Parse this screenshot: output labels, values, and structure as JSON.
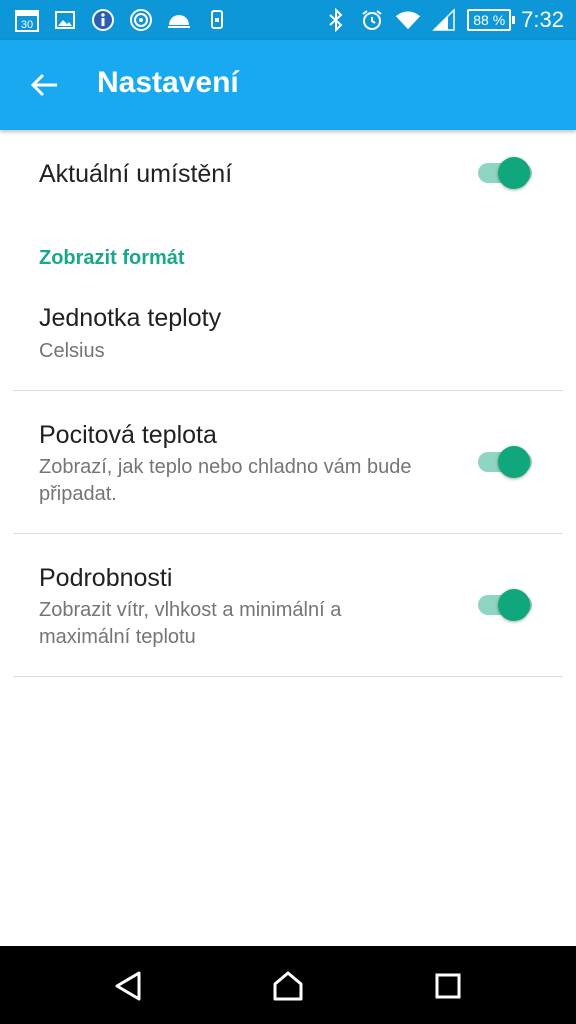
{
  "status_bar": {
    "notification_icons": [
      "calendar-icon",
      "photo-icon",
      "info-icon",
      "hotspot-icon",
      "weather-icon",
      "phone-sync-icon"
    ],
    "calendar_day": "30",
    "battery": "88 %",
    "time": "7:32"
  },
  "app_bar": {
    "title": "Nastavení",
    "back_icon": "arrow-left-icon",
    "color": "#18a9f1"
  },
  "settings": {
    "current_location": {
      "title": "Aktuální umístění",
      "enabled": true
    },
    "category_display_format": "Zobrazit formát",
    "temperature_unit": {
      "title": "Jednotka teploty",
      "value": "Celsius"
    },
    "feels_like": {
      "title": "Pocitová teplota",
      "summary": "Zobrazí, jak teplo nebo chladno vám bude připadat.",
      "enabled": true
    },
    "details": {
      "title": "Podrobnosti",
      "summary": "Zobrazit vítr, vlhkost a minimální a maximální teplotu",
      "enabled": true
    }
  },
  "accent_color": "#1aa88a",
  "nav_bar": [
    "back-triangle-icon",
    "home-icon",
    "recents-icon"
  ]
}
